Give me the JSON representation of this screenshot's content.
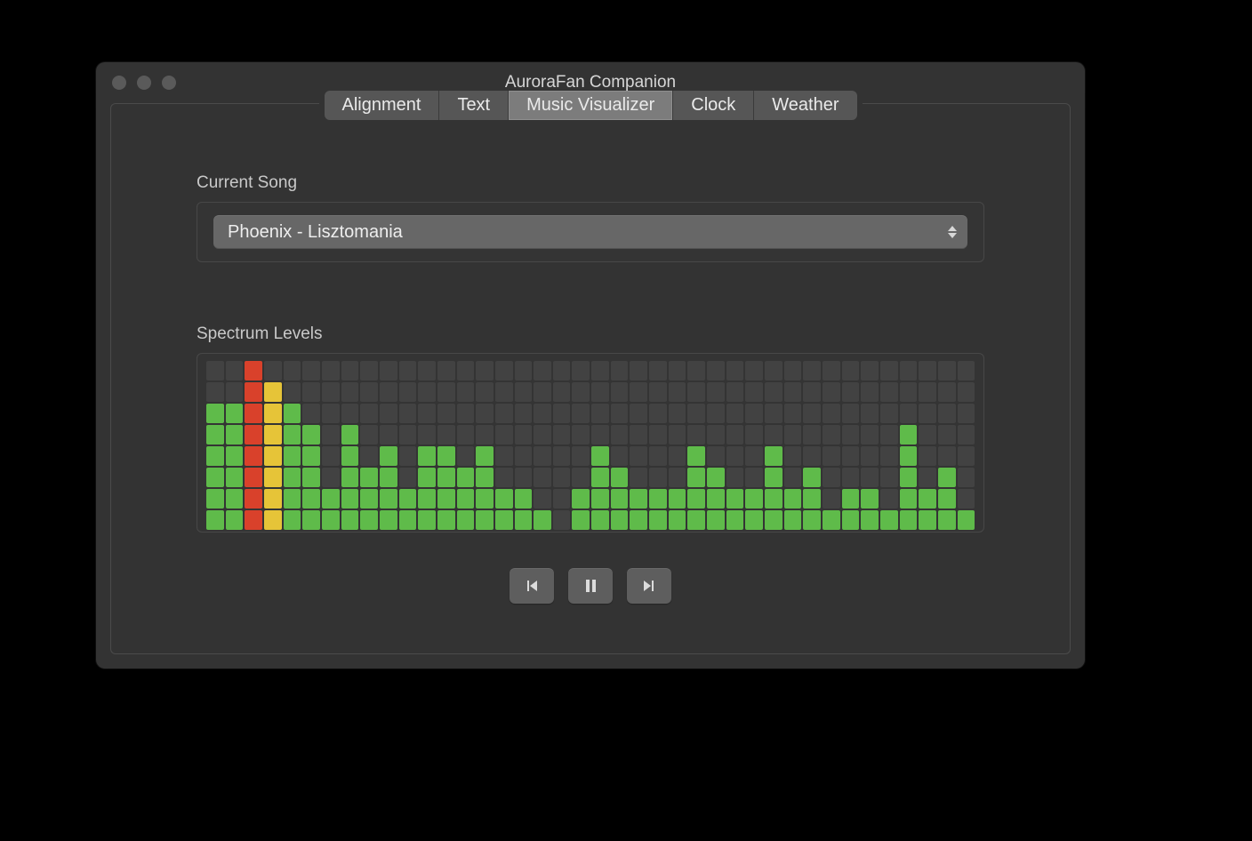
{
  "window": {
    "title": "AuroraFan Companion"
  },
  "tabs": {
    "items": [
      "Alignment",
      "Text",
      "Music Visualizer",
      "Clock",
      "Weather"
    ],
    "active_index": 2
  },
  "current_song": {
    "label": "Current Song",
    "selected": "Phoenix - Lisztomania"
  },
  "spectrum": {
    "label": "Spectrum Levels",
    "segments_per_bar": 8,
    "bars": [
      {
        "lit": 6,
        "tint": "g"
      },
      {
        "lit": 6,
        "tint": "g"
      },
      {
        "lit": 8,
        "tint": "r"
      },
      {
        "lit": 7,
        "tint": "y"
      },
      {
        "lit": 6,
        "tint": "g"
      },
      {
        "lit": 5,
        "tint": "g"
      },
      {
        "lit": 2,
        "tint": "g"
      },
      {
        "lit": 5,
        "tint": "g"
      },
      {
        "lit": 3,
        "tint": "g"
      },
      {
        "lit": 4,
        "tint": "g"
      },
      {
        "lit": 2,
        "tint": "g"
      },
      {
        "lit": 4,
        "tint": "g"
      },
      {
        "lit": 4,
        "tint": "g"
      },
      {
        "lit": 3,
        "tint": "g"
      },
      {
        "lit": 4,
        "tint": "g"
      },
      {
        "lit": 2,
        "tint": "g"
      },
      {
        "lit": 2,
        "tint": "g"
      },
      {
        "lit": 1,
        "tint": "g"
      },
      {
        "lit": 0,
        "tint": "g"
      },
      {
        "lit": 2,
        "tint": "g"
      },
      {
        "lit": 4,
        "tint": "g"
      },
      {
        "lit": 3,
        "tint": "g"
      },
      {
        "lit": 2,
        "tint": "g"
      },
      {
        "lit": 2,
        "tint": "g"
      },
      {
        "lit": 2,
        "tint": "g"
      },
      {
        "lit": 4,
        "tint": "g"
      },
      {
        "lit": 3,
        "tint": "g"
      },
      {
        "lit": 2,
        "tint": "g"
      },
      {
        "lit": 2,
        "tint": "g"
      },
      {
        "lit": 4,
        "tint": "g"
      },
      {
        "lit": 2,
        "tint": "g"
      },
      {
        "lit": 3,
        "tint": "g"
      },
      {
        "lit": 1,
        "tint": "g"
      },
      {
        "lit": 2,
        "tint": "g"
      },
      {
        "lit": 2,
        "tint": "g"
      },
      {
        "lit": 1,
        "tint": "g"
      },
      {
        "lit": 5,
        "tint": "g"
      },
      {
        "lit": 2,
        "tint": "g"
      },
      {
        "lit": 3,
        "tint": "g"
      },
      {
        "lit": 1,
        "tint": "g"
      }
    ]
  },
  "colors": {
    "bar_green": "#5fbb4a",
    "bar_yellow": "#e6c438",
    "bar_red": "#d9412b",
    "window_bg": "#333333"
  }
}
